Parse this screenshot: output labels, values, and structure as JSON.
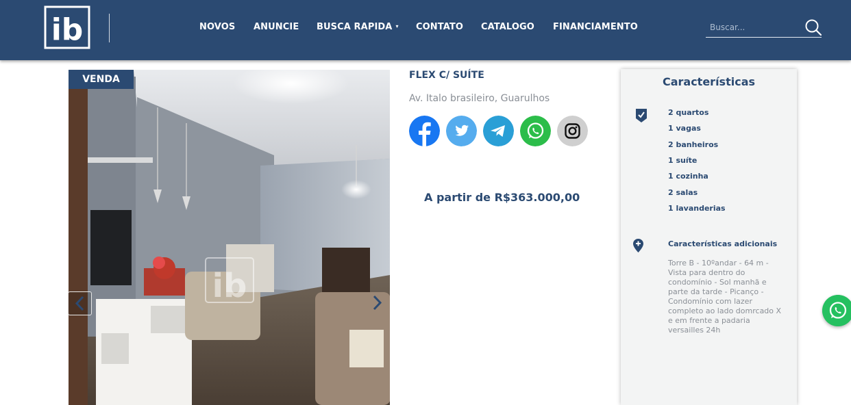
{
  "header": {
    "logo_text": "ib",
    "nav": [
      {
        "label": "NOVOS"
      },
      {
        "label": "ANUNCIE"
      },
      {
        "label": "BUSCA RAPIDA",
        "caret": "▾"
      },
      {
        "label": "CONTATO"
      },
      {
        "label": "CATALOGO"
      },
      {
        "label": "FINANCIAMENTO"
      }
    ],
    "search": {
      "placeholder": "Buscar...",
      "icon": "search-icon"
    }
  },
  "listing": {
    "badge": "VENDA",
    "title": "FLEX C/ SUÍTE",
    "address": "Av. Italo brasileiro, Guarulhos",
    "price": "A partir de R$363.000,00",
    "watermark": "ib",
    "social": [
      {
        "name": "facebook-icon",
        "color": "#1877f2"
      },
      {
        "name": "twitter-icon",
        "color": "#55acee"
      },
      {
        "name": "telegram-icon",
        "color": "#2a9fd6"
      },
      {
        "name": "whatsapp-icon",
        "color": "#2cbd4a"
      },
      {
        "name": "instagram-icon",
        "color": "#cfcfcf"
      }
    ]
  },
  "panel": {
    "title": "Características",
    "features": [
      "2 quartos",
      "1 vagas",
      "2 banheiros",
      "1 suíte",
      "1 cozinha",
      "2 salas",
      "1 lavanderias"
    ],
    "additional_title": "Características adicionais",
    "additional_text": "Torre B - 10ºandar - 64 m - Vista para dentro do condomínio - Sol manhã e parte da tarde - Picanço - Condomínio com lazer completo ao lado domrcado X e em frente a padaria versailles 24h"
  },
  "colors": {
    "brand": "#2b4a72",
    "whatsapp": "#25c060"
  }
}
